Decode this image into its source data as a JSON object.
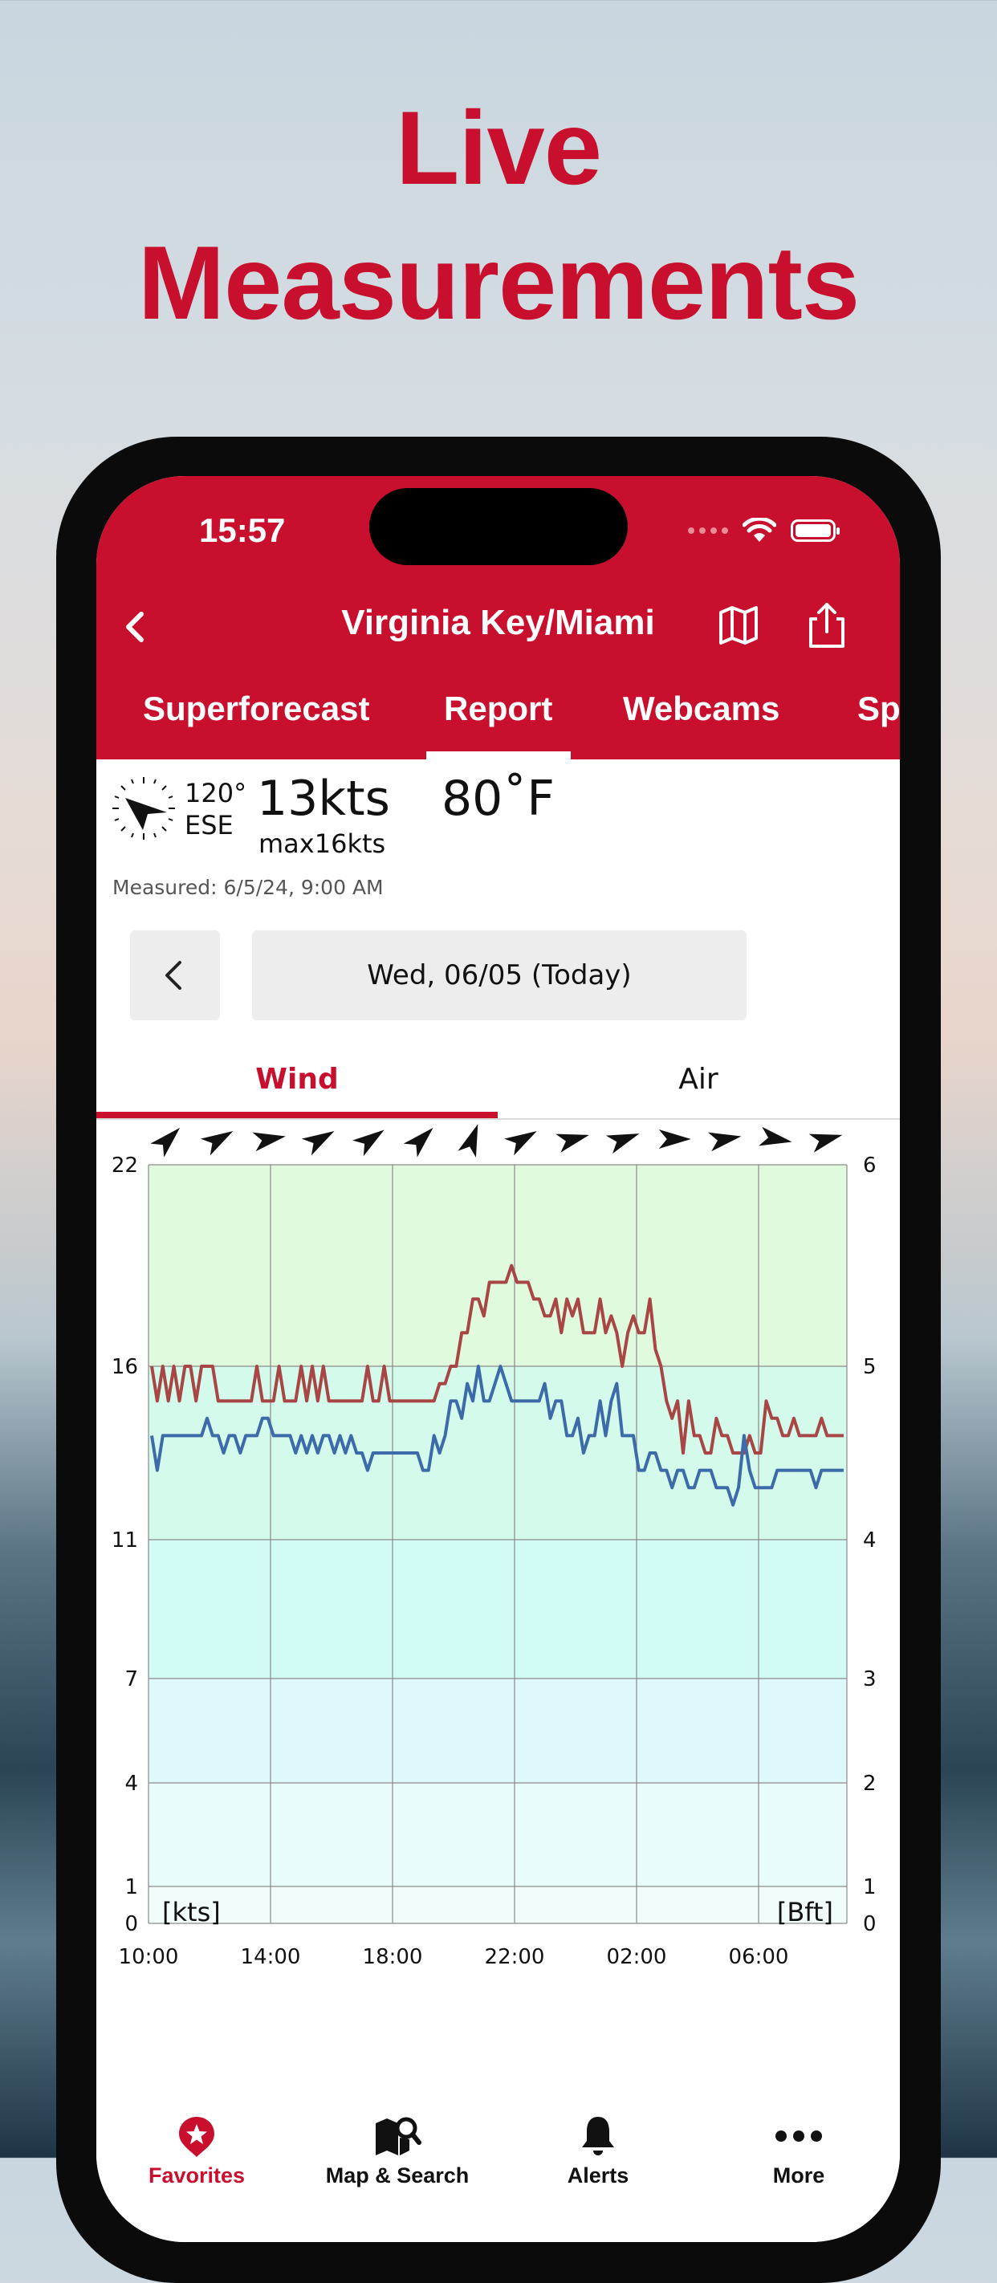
{
  "headline": {
    "line1": "Live",
    "line2": "Measurements"
  },
  "status_bar": {
    "time": "15:57"
  },
  "nav": {
    "title": "Virginia Key/Miami",
    "back_icon": "chevron-left-icon",
    "map_icon": "map-icon",
    "share_icon": "share-icon"
  },
  "tabs": [
    {
      "label": "Superforecast"
    },
    {
      "label": "Report",
      "active": true
    },
    {
      "label": "Webcams"
    },
    {
      "label": "Spo"
    }
  ],
  "current": {
    "direction_deg": "120°",
    "direction_name": "ESE",
    "wind_speed": "13kts",
    "wind_max": "max16kts",
    "temperature": "80˚F",
    "measured": "Measured: 6/5/24, 9:00 AM"
  },
  "date_nav": {
    "prev_icon": "chevron-left-icon",
    "date_label": "Wed, 06/05 (Today)"
  },
  "view_tabs": {
    "wind": "Wind",
    "air": "Air"
  },
  "chart_data": {
    "type": "line",
    "x_tick_labels": [
      "10:00",
      "14:00",
      "18:00",
      "22:00",
      "02:00",
      "06:00"
    ],
    "y_left_ticks": [
      0,
      1,
      4,
      7,
      11,
      16,
      22
    ],
    "y_right_ticks": [
      0,
      1,
      2,
      3,
      4,
      5,
      6
    ],
    "y_left_unit": "[kts]",
    "y_right_unit": "[Bft]",
    "band_colors": [
      "#f2fdfb",
      "#e8fcfb",
      "#dff9fb",
      "#d2fbf6",
      "#d3faea",
      "#e0fadd"
    ],
    "series": [
      {
        "color": "#a84545",
        "values": [
          16,
          15,
          16,
          15,
          16,
          15,
          16,
          16,
          15,
          16,
          16,
          16,
          15,
          15,
          15,
          15,
          15,
          15,
          15,
          16,
          15,
          15,
          15,
          16,
          15,
          15,
          15,
          16,
          15,
          16,
          15,
          16,
          15,
          15,
          15,
          15,
          15,
          15,
          15,
          16,
          15,
          15,
          16,
          15,
          15,
          15,
          15,
          15,
          15,
          15,
          15,
          15,
          15.5,
          15.5,
          16,
          16,
          17,
          17,
          18,
          18,
          17.5,
          18.5,
          18.5,
          18.5,
          18.5,
          19,
          18.5,
          18.5,
          18.5,
          18,
          18,
          17.5,
          17.5,
          18,
          17,
          18,
          17.5,
          18,
          17,
          17,
          17,
          18,
          17,
          17.5,
          17,
          16,
          17,
          17.5,
          17,
          17,
          18,
          16.5,
          16,
          15,
          14.5,
          15,
          13.5,
          15,
          14,
          14,
          13.5,
          13.5,
          14.5,
          14,
          14,
          13.5,
          13.5,
          13.5,
          14,
          13.5,
          13.5,
          15,
          14.5,
          14.5,
          14,
          14,
          14.5,
          14,
          14,
          14,
          14,
          14.5,
          14,
          14,
          14,
          14
        ]
      },
      {
        "color": "#3d6aa8",
        "values": [
          14,
          13,
          14,
          14,
          14,
          14,
          14,
          14,
          14,
          14,
          14.5,
          14,
          14,
          13.5,
          14,
          14,
          13.5,
          14,
          14,
          14,
          14.5,
          14.5,
          14,
          14,
          14,
          14,
          13.5,
          14,
          13.5,
          14,
          13.5,
          14,
          14,
          13.5,
          14,
          13.5,
          14,
          13.5,
          13.5,
          13,
          13.5,
          13.5,
          13.5,
          13.5,
          13.5,
          13.5,
          13.5,
          13.5,
          13.5,
          13,
          13,
          14,
          13.5,
          14,
          15,
          15,
          14.5,
          15.5,
          15,
          16,
          15,
          15,
          15.5,
          16,
          15.5,
          15,
          15,
          15,
          15,
          15,
          15,
          15.5,
          14.5,
          15,
          15,
          14,
          14,
          14.5,
          13.5,
          14,
          14,
          15,
          14,
          15,
          15.5,
          14,
          14,
          14,
          13,
          13,
          13.5,
          13.5,
          13,
          13,
          12.5,
          13,
          13,
          12.5,
          12.5,
          13,
          13,
          13,
          12.5,
          12.5,
          12.5,
          12,
          12.5,
          14,
          13,
          12.5,
          12.5,
          12.5,
          12.5,
          13,
          13,
          13,
          13,
          13,
          13,
          13,
          12.5,
          13,
          13,
          13,
          13,
          13
        ]
      }
    ],
    "direction_arrows_deg": [
      45,
      60,
      80,
      60,
      55,
      45,
      20,
      60,
      75,
      70,
      90,
      80,
      100,
      75
    ]
  },
  "bottom_nav": [
    {
      "label": "Favorites",
      "icon": "star-badge-icon",
      "active": true
    },
    {
      "label": "Map & Search",
      "icon": "map-search-icon"
    },
    {
      "label": "Alerts",
      "icon": "bell-icon"
    },
    {
      "label": "More",
      "icon": "more-dots-icon"
    }
  ]
}
